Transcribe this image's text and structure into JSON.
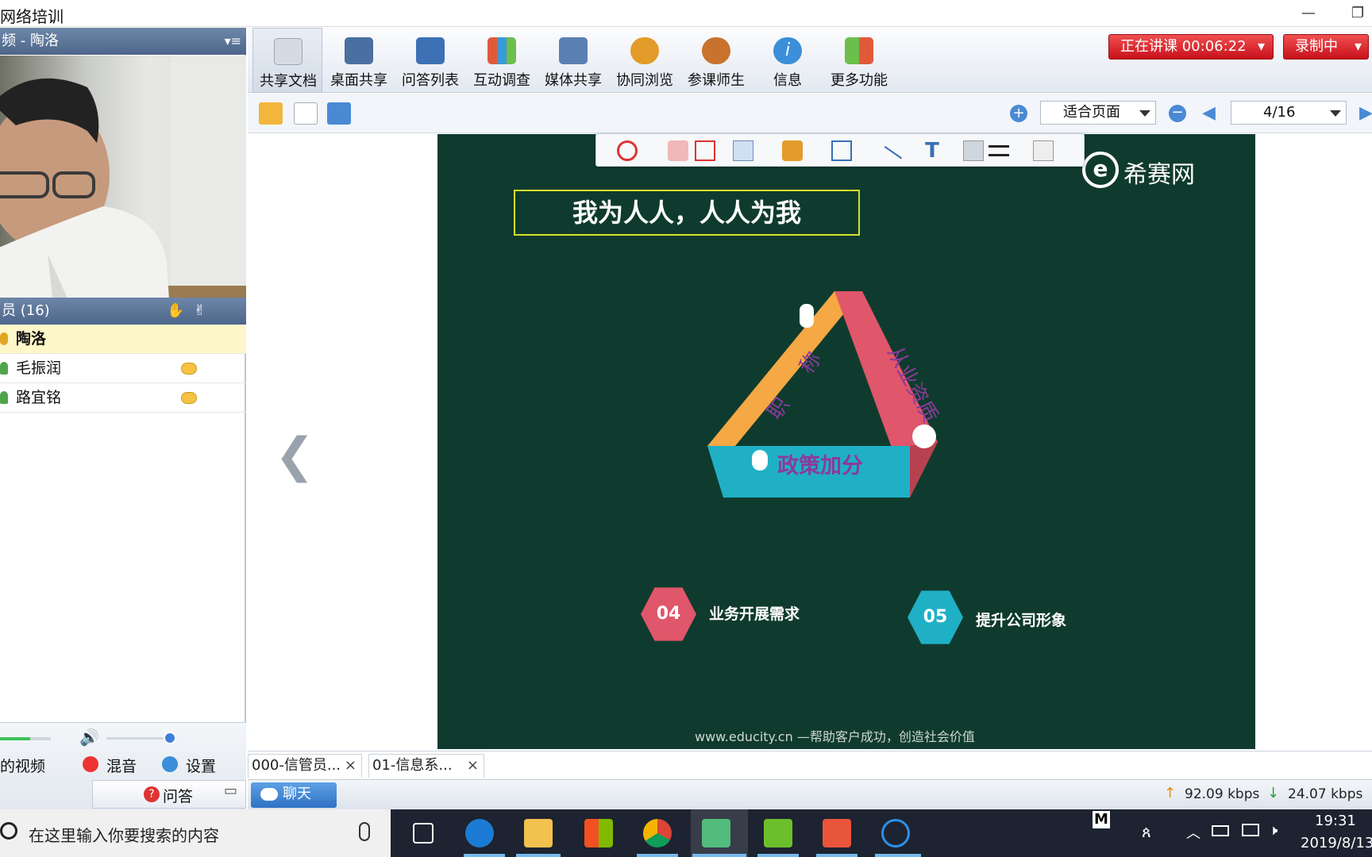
{
  "window": {
    "title": "网络培训"
  },
  "left": {
    "video_header": "频 - 陶洛",
    "members_header": "员 (16)",
    "members": [
      {
        "name": "陶洛",
        "highlight": true
      },
      {
        "name": "毛振润",
        "highlight": false
      },
      {
        "name": "路宜铭",
        "highlight": false
      }
    ],
    "my_video": "的视频",
    "mix_label": "混音",
    "settings_label": "设置",
    "qa_label": "问答"
  },
  "toolbar": {
    "tools": [
      {
        "label": "共享文档",
        "color": "#d6dbe3",
        "icon": "document-icon"
      },
      {
        "label": "桌面共享",
        "color": "#4a6fa0",
        "icon": "desktop-share-icon"
      },
      {
        "label": "问答列表",
        "color": "#3d70b5",
        "icon": "qa-list-icon"
      },
      {
        "label": "互动调查",
        "color": "#e05a3a",
        "icon": "poll-chart-icon"
      },
      {
        "label": "媒体共享",
        "color": "#5a7fb3",
        "icon": "media-share-icon"
      },
      {
        "label": "协同浏览",
        "color": "#e39b2a",
        "icon": "co-browse-icon"
      },
      {
        "label": "参课师生",
        "color": "#c9722e",
        "icon": "participants-icon"
      },
      {
        "label": "信息",
        "color": "#3a8fd8",
        "icon": "info-icon"
      },
      {
        "label": "更多功能",
        "color": "#6cbf4b",
        "icon": "more-functions-icon"
      }
    ],
    "lecturing_label": "正在讲课 00:06:22",
    "recording_label": "录制中"
  },
  "subbar": {
    "zoom_option": "适合页面",
    "page_indicator": "4/16"
  },
  "slide": {
    "title": "我为人人，人人为我",
    "brand": "希赛网",
    "side_left": "职 称",
    "side_right": "从业资质",
    "side_bottom": "政策加分",
    "item4_num": "04",
    "item4_text": "业务开展需求",
    "item5_num": "05",
    "item5_text": "提升公司形象",
    "footer": "www.educity.cn —帮助客户成功，创造社会价值"
  },
  "tabs": [
    {
      "label": "000-信管员..."
    },
    {
      "label": "01-信息系..."
    }
  ],
  "status": {
    "chat_label": "聊天",
    "upload": "92.09 kbps",
    "download": "24.07 kbps"
  },
  "taskbar": {
    "search_placeholder": "在这里输入你要搜索的内容",
    "time": "19:31",
    "date": "2019/8/13",
    "ime": "M",
    "prev_arrow": "❮"
  }
}
